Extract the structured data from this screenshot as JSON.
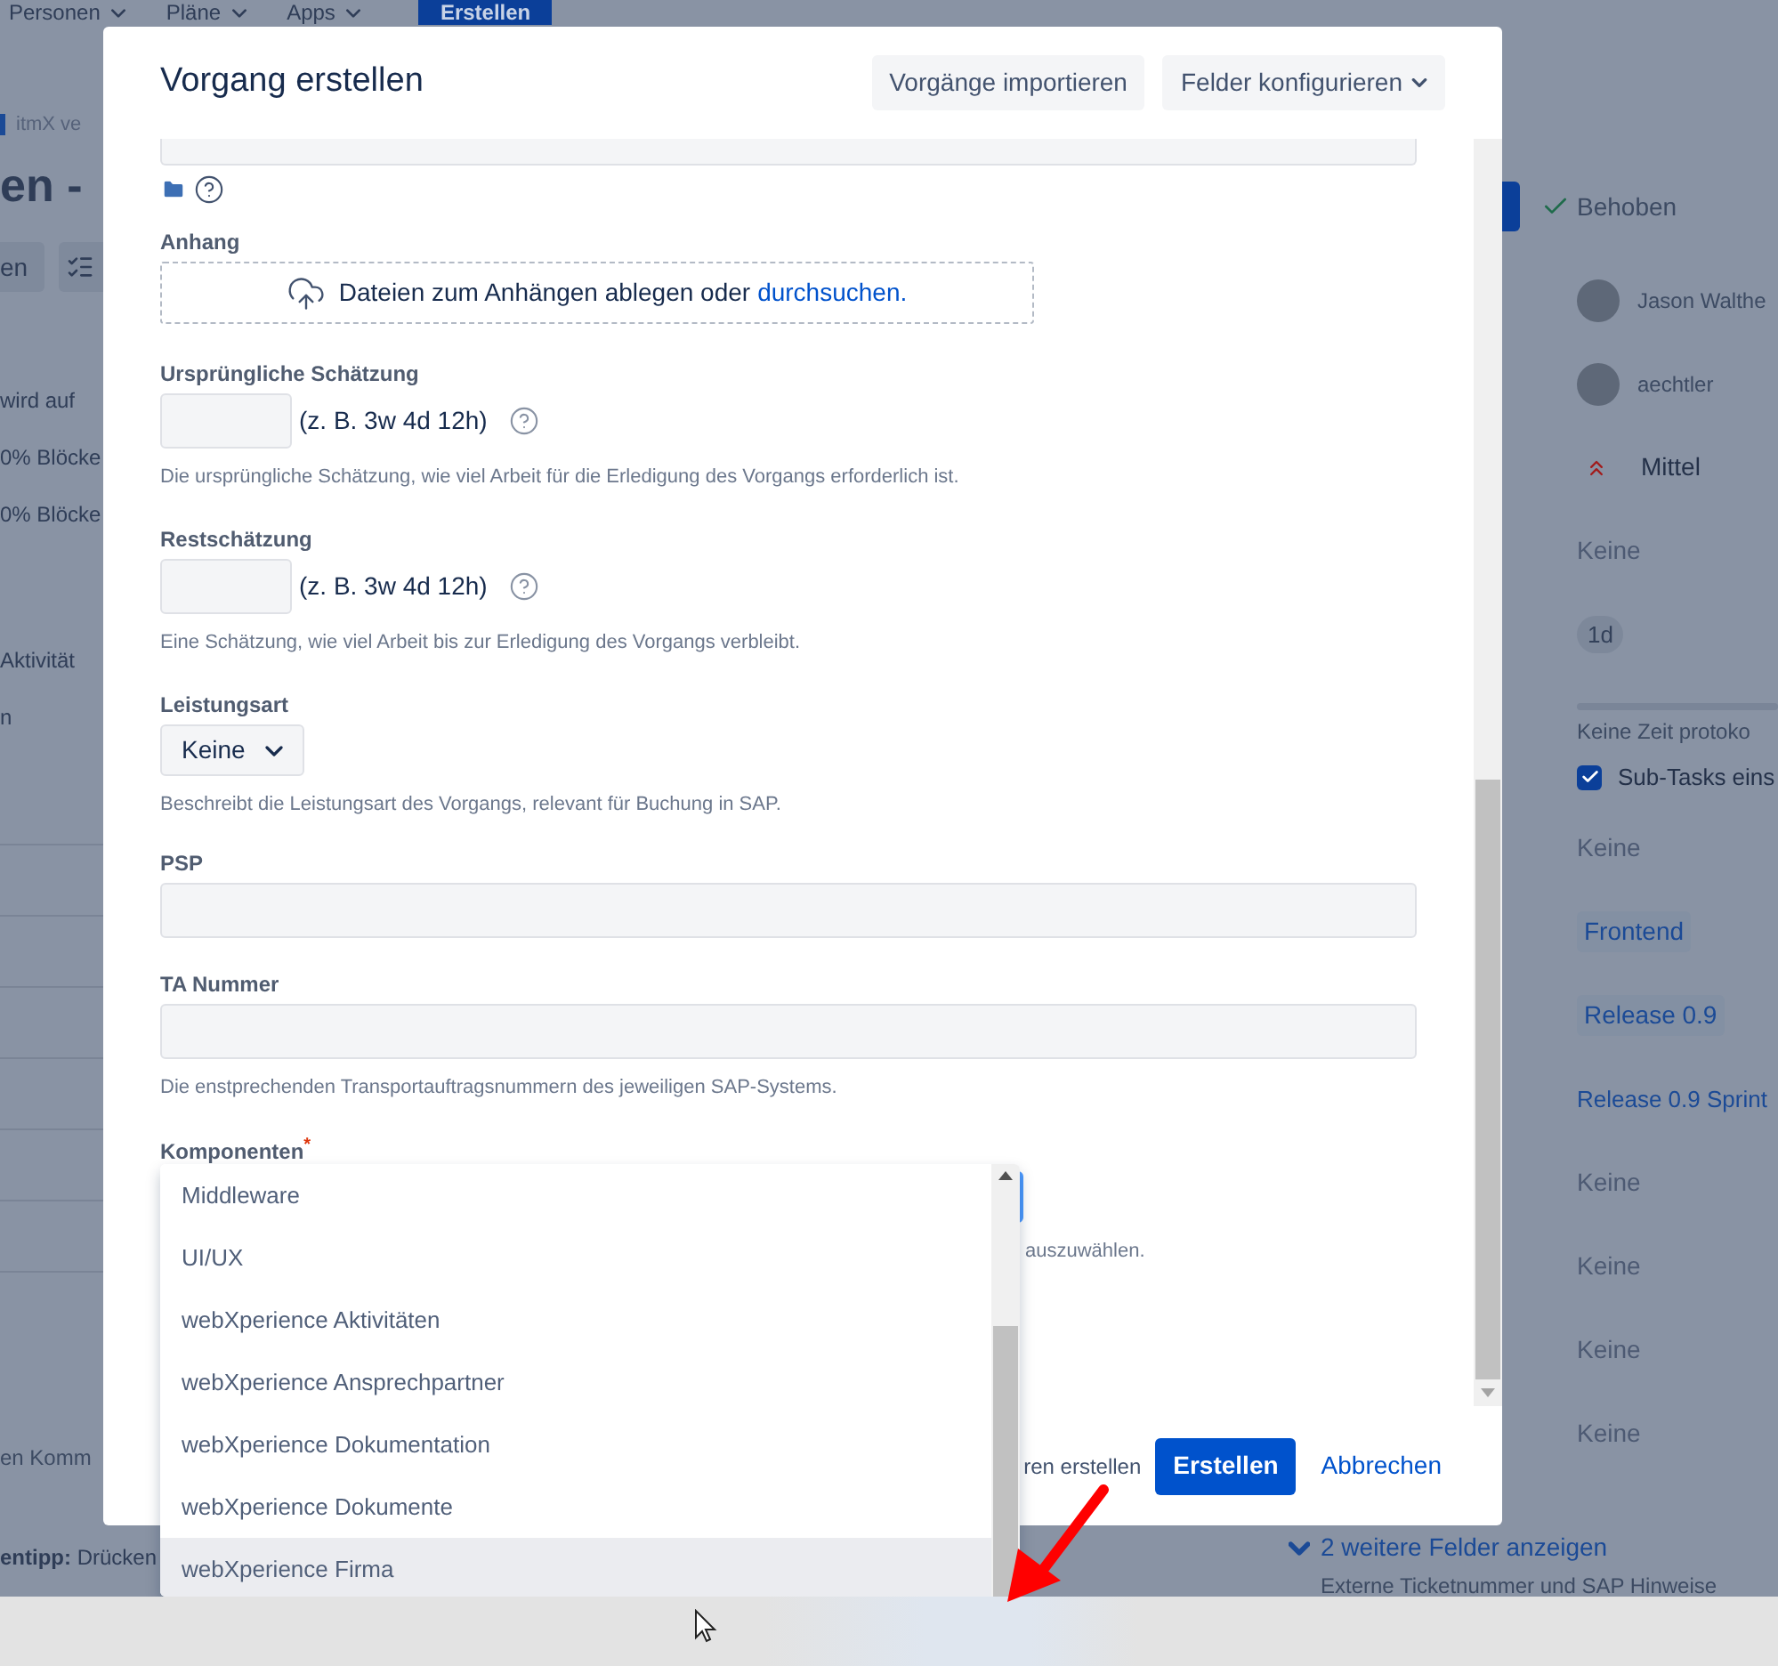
{
  "background_page": {
    "nav": [
      {
        "kind": "menu",
        "label": "Personen"
      },
      {
        "kind": "menu",
        "label": "Pläne"
      },
      {
        "kind": "menu",
        "label": "Apps"
      },
      {
        "kind": "button",
        "label": "Erstellen"
      }
    ],
    "breadcrumb": "itmX ve",
    "title": "en -",
    "toolbar_label": "en",
    "left_texts": [
      "wird auf",
      "0% Blöcke",
      "0% Blöcke",
      "Aktivität",
      "n"
    ],
    "comment_hint": "en Komm",
    "tip": "**entipp:** Drücken",
    "details": [
      {
        "kind": "status",
        "text": "Behoben"
      },
      {
        "kind": "person",
        "text": "Jason Walthe"
      },
      {
        "kind": "person",
        "text": "aechtler"
      },
      {
        "kind": "priority",
        "text": "Mittel"
      },
      {
        "kind": "text",
        "text": "Keine"
      },
      {
        "kind": "lozenge",
        "text": "1d"
      },
      {
        "kind": "timetracking",
        "text": "Keine Zeit protoko",
        "level": 0
      },
      {
        "kind": "checkbox",
        "text": "Sub-Tasks eins",
        "checked": true
      },
      {
        "kind": "text",
        "text": "Keine"
      },
      {
        "kind": "tag",
        "text": "Frontend"
      },
      {
        "kind": "tag",
        "text": "Release 0.9"
      },
      {
        "kind": "link",
        "text": "Release 0.9 Sprint"
      },
      {
        "kind": "text",
        "text": "Keine"
      },
      {
        "kind": "text",
        "text": "Keine"
      },
      {
        "kind": "text",
        "text": "Keine"
      },
      {
        "kind": "text",
        "text": "Keine"
      }
    ],
    "more_fields": {
      "label": "2 weitere Felder anzeigen",
      "sub": "Externe Ticketnummer und SAP Hinweise"
    }
  },
  "dialog": {
    "title": "Vorgang erstellen",
    "header_buttons": [
      {
        "label": "Vorgänge importieren",
        "dropdown": false
      },
      {
        "label": "Felder konfigurieren",
        "dropdown": true
      }
    ],
    "fields": [
      {
        "kind": "attachment",
        "label": "Anhang",
        "text": "Dateien zum Anhängen ablegen oder",
        "link": "durchsuchen."
      },
      {
        "kind": "estimate",
        "label": "Ursprüngliche Schätzung",
        "hint": "(z. B. 3w 4d 12h)",
        "description": "Die ursprüngliche Schätzung, wie viel Arbeit für die Erledigung des Vorgangs erforderlich ist."
      },
      {
        "kind": "estimate",
        "label": "Restschätzung",
        "hint": "(z. B. 3w 4d 12h)",
        "description": "Eine Schätzung, wie viel Arbeit bis zur Erledigung des Vorgangs verbleibt."
      },
      {
        "kind": "select",
        "label": "Leistungsart",
        "value": "Keine",
        "description": "Beschreibt die Leistungsart des Vorgangs, relevant für Buchung in SAP."
      },
      {
        "kind": "text",
        "label": "PSP"
      },
      {
        "kind": "text",
        "label": "TA Nummer",
        "description": "Die enstprechenden Transportauftragsnummern des jeweiligen SAP-Systems."
      },
      {
        "kind": "combobox",
        "label": "Komponenten",
        "required_mark": "*",
        "focused": true,
        "description": "auszuwählen."
      }
    ],
    "footer": {
      "checkbox_label": "ren erstellen",
      "primary": "Erstellen",
      "cancel": "Abbrechen"
    },
    "dropdown": {
      "options": [
        {
          "label": "Middleware",
          "selected": false
        },
        {
          "label": "UI/UX",
          "selected": false
        },
        {
          "label": "webXperience Aktivitäten",
          "selected": false
        },
        {
          "label": "webXperience Ansprechpartner",
          "selected": false
        },
        {
          "label": "webXperience Dokumentation",
          "selected": false
        },
        {
          "label": "webXperience Dokumente",
          "selected": false
        },
        {
          "label": "webXperience Firma",
          "selected": true
        }
      ]
    }
  }
}
